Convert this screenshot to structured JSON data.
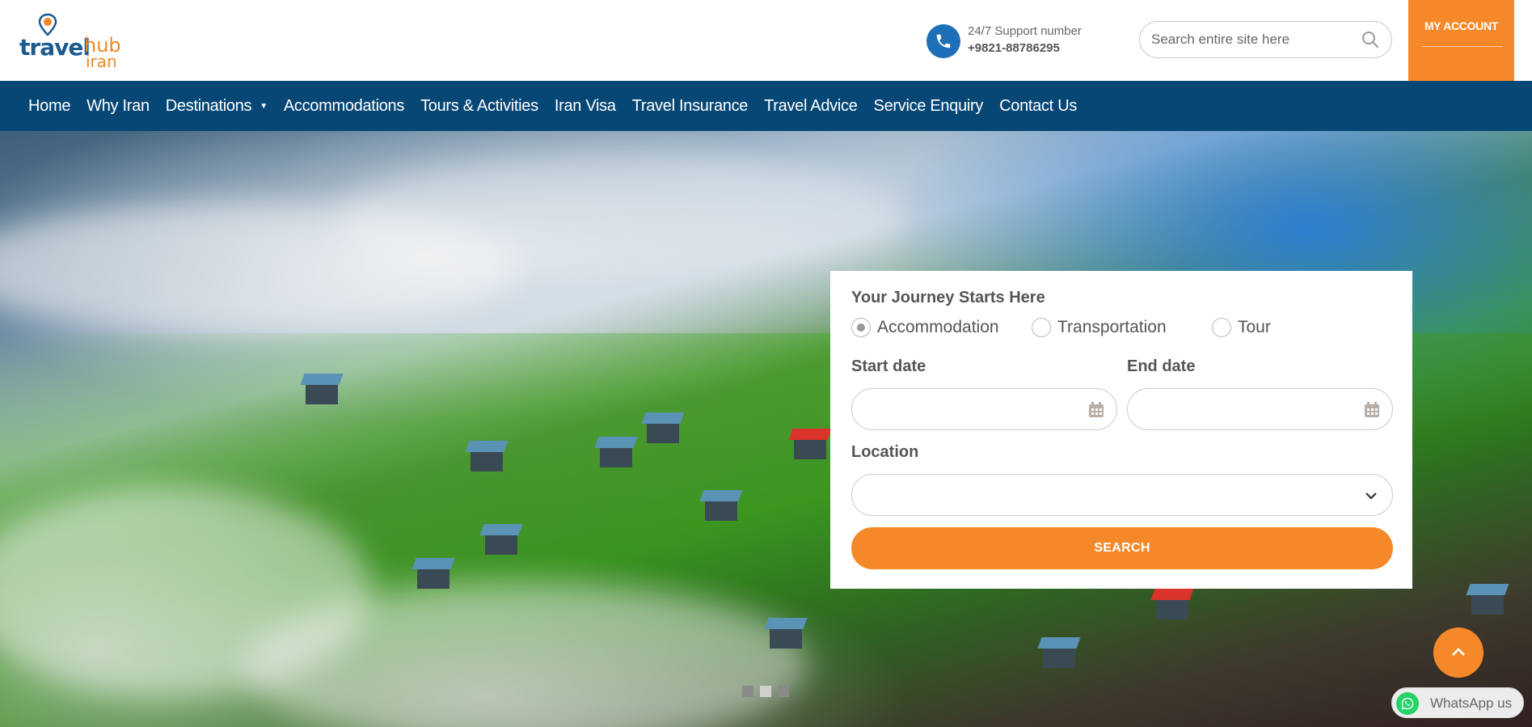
{
  "header": {
    "logo": {
      "word1": "travel",
      "word2": "hub",
      "word3": "iran"
    },
    "support": {
      "label": "24/7 Support number",
      "phone": "+9821-88786295"
    },
    "search": {
      "placeholder": "Search entire site here"
    },
    "account": {
      "label": "MY ACCOUNT",
      "color": "#f5892a"
    }
  },
  "nav": {
    "items": [
      {
        "label": "Home"
      },
      {
        "label": "Why Iran"
      },
      {
        "label": "Destinations",
        "has_dropdown": true
      },
      {
        "label": "Accommodations"
      },
      {
        "label": "Tours & Activities"
      },
      {
        "label": "Iran Visa"
      },
      {
        "label": "Travel Insurance"
      },
      {
        "label": "Travel Advice"
      },
      {
        "label": "Service Enquiry"
      },
      {
        "label": "Contact Us"
      }
    ],
    "color": "#064776"
  },
  "hero": {
    "slides": {
      "count": 3,
      "active_index": 1
    }
  },
  "search_card": {
    "title": "Your Journey Starts Here",
    "options": [
      {
        "label": "Accommodation",
        "checked": true
      },
      {
        "label": "Transportation",
        "checked": false
      },
      {
        "label": "Tour",
        "checked": false
      }
    ],
    "start_date_label": "Start date",
    "end_date_label": "End date",
    "start_date_value": "",
    "end_date_value": "",
    "location_label": "Location",
    "location_value": "",
    "button_label": "SEARCH",
    "accent_color": "#f5892a"
  },
  "widgets": {
    "whatsapp_label": "WhatsApp us",
    "scroll_top_icon": "chevron-up-icon"
  }
}
